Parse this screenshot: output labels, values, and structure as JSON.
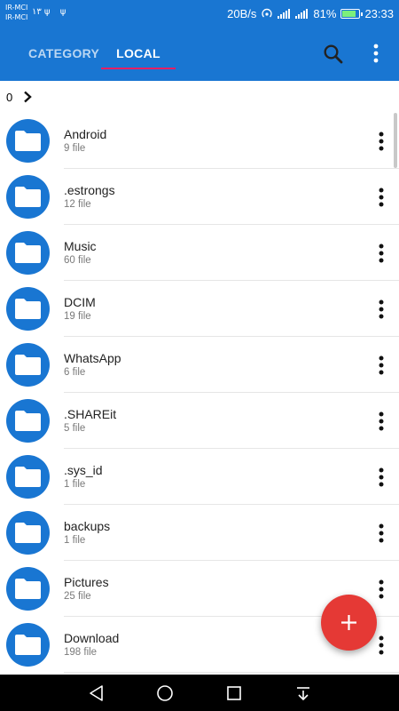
{
  "status_bar": {
    "carrier_1": "IR-MCI",
    "carrier_2": "IR-MCI",
    "left_icons": "۱۳ ψ ψ",
    "speed": "20B/s",
    "battery": "81%",
    "battery_level": 0.81,
    "time": "23:33",
    "icons": [
      "hotspot-icon",
      "signal-icon",
      "signal-icon",
      "battery-icon"
    ]
  },
  "app_bar": {
    "tabs": [
      {
        "label": "CATEGORY",
        "active": false
      },
      {
        "label": "LOCAL",
        "active": true
      }
    ],
    "accent_color": "#1976d2",
    "tab_indicator_color": "#e91e63",
    "actions": [
      "search-icon",
      "more-vert-icon"
    ]
  },
  "breadcrumb": {
    "path": "0",
    "icon": "chevron-right-icon"
  },
  "files": [
    {
      "name": "Android",
      "count": "9 file"
    },
    {
      "name": ".estrongs",
      "count": "12 file"
    },
    {
      "name": "Music",
      "count": "60 file"
    },
    {
      "name": "DCIM",
      "count": "19 file"
    },
    {
      "name": "WhatsApp",
      "count": "6 file"
    },
    {
      "name": ".SHAREit",
      "count": "5 file"
    },
    {
      "name": ".sys_id",
      "count": "1 file"
    },
    {
      "name": "backups",
      "count": "1 file"
    },
    {
      "name": "Pictures",
      "count": "25 file"
    },
    {
      "name": "Download",
      "count": "198 file"
    }
  ],
  "fab": {
    "icon": "plus-icon",
    "color": "#e53935"
  },
  "nav_bar": {
    "buttons": [
      "back-icon",
      "home-icon",
      "recents-icon",
      "notifications-pull-icon"
    ]
  }
}
